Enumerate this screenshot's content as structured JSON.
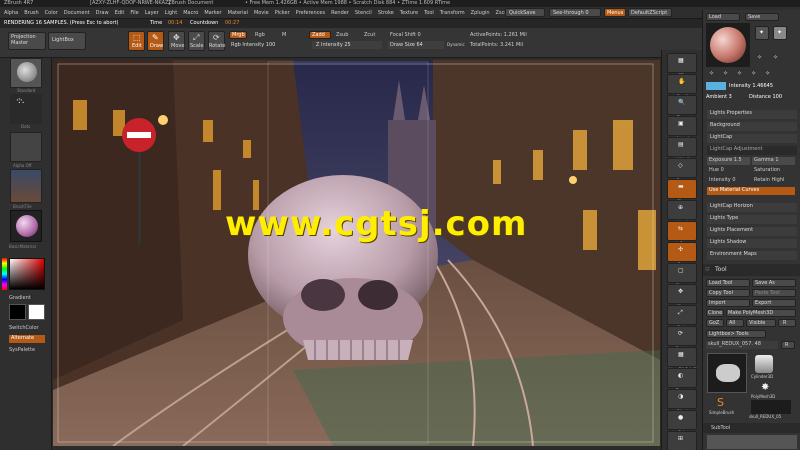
{
  "title": {
    "app": "ZBrush 4R7",
    "serial": "[AZXY-ZLHF-QDOF-NRWE-NKAZ]",
    "document": "ZBrush Document",
    "memory": "• Free Mem 1.426GB • Active Mem 1988 • Scratch Disk 884 • ZTime 1.609 RTime"
  },
  "menu": {
    "items": [
      "Alpha",
      "Brush",
      "Color",
      "Document",
      "Draw",
      "Edit",
      "File",
      "Layer",
      "Light",
      "Macro",
      "Marker",
      "Material",
      "Movie",
      "Picker",
      "Preferences",
      "Render",
      "Stencil",
      "Stroke",
      "Texture",
      "Tool",
      "Transform",
      "Zplugin",
      "Zscript"
    ],
    "quicksave": "QuickSave",
    "seethrough": "See-through  0",
    "menus": "Menus",
    "defaultzscript": "DefaultZScript"
  },
  "status": {
    "rendering": "RENDERING 16 SAMPLES. (Press Esc to abort)",
    "time_label": "Time",
    "time": "00:14",
    "countdown_label": "Countdown",
    "countdown": "00:27"
  },
  "top": {
    "projection_master": "Projection Master",
    "lightbox": "LightBox",
    "edit": "Edit",
    "draw": "Draw",
    "move": "Move",
    "scale": "Scale",
    "rotate": "Rotate",
    "mrgb": "Mrgb",
    "rgb": "Rgb",
    "m": "M",
    "rgb_intensity": "Rgb Intensity 100",
    "zadd": "Zadd",
    "zsub": "Zsub",
    "zcut": "Zcut",
    "z_intensity": "Z Intensity 25",
    "focal_shift": "Focal Shift 0",
    "draw_size": "Draw Size 64",
    "dynamic": "Dynamic",
    "active_points": "ActivePoints: 1.261 Mil",
    "total_points": "TotalPoints: 3.241 Mil"
  },
  "left": {
    "standard": "Standard",
    "dots": "Dots",
    "alpha_off": "Alpha Off",
    "brushtile": "BrushTile",
    "basicmaterial": "BasicMaterial",
    "gradient": "Gradient",
    "switchcolor": "SwitchColor",
    "alternate": "Alternate",
    "syspalette": "SysPalette"
  },
  "right_shelf": [
    "SPix",
    "Scroll",
    "Zoom",
    "Actual",
    "AAHalf",
    "Persp",
    "Floor",
    "Local",
    "L.Sym",
    "Gxyz",
    "Frame",
    "Move",
    "Scale",
    "Rotate",
    "Line Fill PolyF",
    "Transp",
    "Ghost",
    "Solo",
    "Xpose"
  ],
  "tray": {
    "load": "Load",
    "save": "Save",
    "intensity": "Intensity 1.46645",
    "ambient": "Ambient 3",
    "distance": "Distance 100",
    "lights_props": "Lights Properties",
    "background": "Background",
    "lightcap": "LightCap",
    "lightcap_adjust": "LightCap Adjustment",
    "exposure": "Exposure 1.5",
    "gamma": "Gamma 1",
    "hue": "Hue 0",
    "saturation": "Saturation",
    "intensity0": "Intensity 0",
    "retain_high": "Retain Highl",
    "use_material": "Use Material Curves",
    "lightcap_horizon": "LightCap Horizon",
    "lights_type": "Lights Type",
    "lights_placement": "Lights Placement",
    "lights_shadow": "Lights Shadow",
    "env_maps": "Environment Maps",
    "tool": "Tool",
    "load_tool": "Load Tool",
    "save_as": "Save As",
    "copy_tool": "Copy Tool",
    "paste_tool": "Paste Tool",
    "import": "Import",
    "export": "Export",
    "clone": "Clone",
    "make_polymesh": "Make PolyMesh3D",
    "goz": "GoZ",
    "all": "All",
    "visible": "Visible",
    "r": "R",
    "lightbox_tools": "Lightbox> Tools",
    "current_tool": "skull_REDUX_057. 48",
    "cylinder": "Cylinder3D",
    "polymesh": "PolyMesh3D",
    "simplebrush": "SimpleBrush",
    "skull_thumb": "skull_REDUX_05",
    "subtool": "SubTool"
  },
  "watermark": "www.cgtsj.com",
  "colors": {
    "accent": "#e8882a",
    "watermark": "#ffee00"
  }
}
